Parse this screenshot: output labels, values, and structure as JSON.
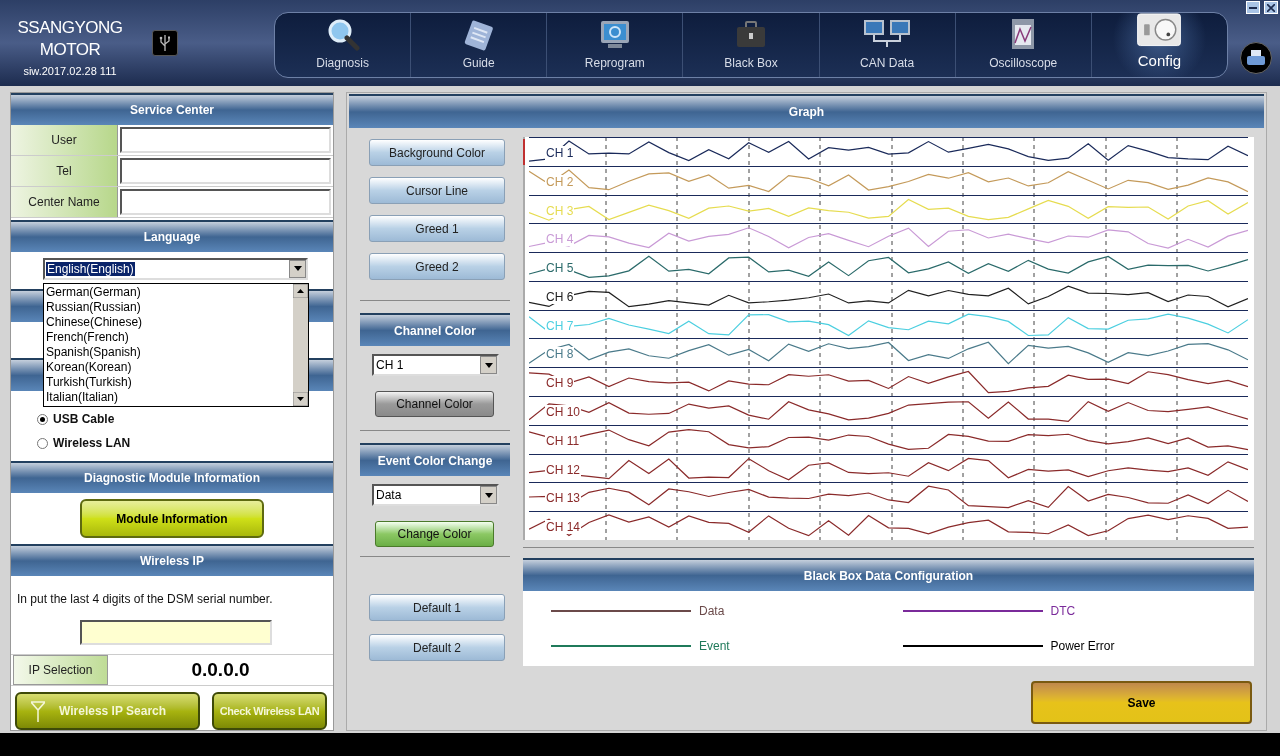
{
  "header": {
    "brand_line1": "SSANGYONG",
    "brand_line2": "MOTOR",
    "version": "siw.2017.02.28 111"
  },
  "nav": [
    {
      "label": "Diagnosis",
      "kind": "magnifier",
      "selected": false
    },
    {
      "label": "Guide",
      "kind": "notepad",
      "selected": false
    },
    {
      "label": "Reprogram",
      "kind": "monitor",
      "selected": false
    },
    {
      "label": "Black Box",
      "kind": "briefcase",
      "selected": false
    },
    {
      "label": "CAN Data",
      "kind": "network",
      "selected": false
    },
    {
      "label": "Oscilloscope",
      "kind": "scope",
      "selected": false
    },
    {
      "label": "Config",
      "kind": "dial",
      "selected": true
    }
  ],
  "service_center": {
    "title": "Service Center",
    "fields": [
      {
        "label": "User"
      },
      {
        "label": "Tel"
      },
      {
        "label": "Center Name"
      }
    ]
  },
  "language": {
    "title": "Language",
    "value": "English(English)",
    "expanded": true,
    "options": [
      "German(German)",
      "Russian(Russian)",
      "Chinese(Chinese)",
      "French(French)",
      "Spanish(Spanish)",
      "Korean(Korean)",
      "Turkish(Turkish)",
      "Italian(Italian)"
    ]
  },
  "connection": {
    "options": [
      {
        "label": "USB Cable",
        "selected": true
      },
      {
        "label": "Wireless LAN",
        "selected": false
      }
    ]
  },
  "module": {
    "title": "Diagnostic Module Information",
    "button": "Module Information"
  },
  "wireless_ip": {
    "title": "Wireless IP",
    "instruction": "In put the last 4 digits of the DSM serial number.",
    "ip_label": "IP Selection",
    "ip_value": "0.0.0.0",
    "search_button": "Wireless IP Search",
    "check_button": "Check Wireless LAN"
  },
  "graph": {
    "title": "Graph",
    "buttons": [
      "Background Color",
      "Cursor Line",
      "Greed 1",
      "Greed 2"
    ],
    "channel_color": {
      "title": "Channel Color",
      "value": "CH 1",
      "button": "Channel Color"
    },
    "event_color": {
      "title": "Event Color Change",
      "value": "Data",
      "button": "Change Color"
    },
    "defaults": [
      "Default 1",
      "Default 2"
    ],
    "channels": [
      {
        "label": "CH 1",
        "color": "#1a2a5a"
      },
      {
        "label": "CH 2",
        "color": "#c49a5a"
      },
      {
        "label": "CH 3",
        "color": "#e6dc50"
      },
      {
        "label": "CH 4",
        "color": "#c99ad6"
      },
      {
        "label": "CH 5",
        "color": "#2a6a6a"
      },
      {
        "label": "CH 6",
        "color": "#202020"
      },
      {
        "label": "CH 7",
        "color": "#4ccfe0"
      },
      {
        "label": "CH 8",
        "color": "#4a7a8a"
      },
      {
        "label": "CH 9",
        "color": "#8a2a2a"
      },
      {
        "label": "CH 10",
        "color": "#8a2a2a"
      },
      {
        "label": "CH 11",
        "color": "#8a2a2a"
      },
      {
        "label": "CH 12",
        "color": "#8a2a2a"
      },
      {
        "label": "CH 13",
        "color": "#8a2a2a"
      },
      {
        "label": "CH 14",
        "color": "#8a2a2a"
      }
    ]
  },
  "black_box": {
    "title": "Black Box Data Configuration",
    "legend": [
      {
        "label": "Data",
        "color": "#6b4a4a"
      },
      {
        "label": "DTC",
        "color": "#7a2a9a"
      },
      {
        "label": "Event",
        "color": "#1f7a5a"
      },
      {
        "label": "Power Error",
        "color": "#000000"
      }
    ]
  },
  "save": "Save"
}
